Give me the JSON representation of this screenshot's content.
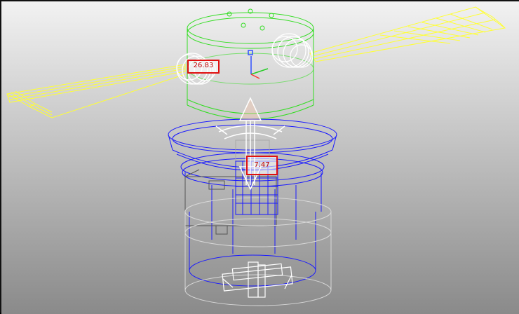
{
  "viewport": {
    "background_top": "#f2f2f2",
    "background_bottom": "#8a8a8a",
    "colors": {
      "blade": "#ffff33",
      "upper_housing": "#33dd22",
      "lower_housing": "#1a1aff",
      "base_ghost": "#d8d8d8",
      "gizmo": "#ffffff",
      "hub": "#a8a8a8",
      "dimension_box": "#e01010",
      "axis_x": "#ff3030",
      "axis_y": "#22cc22",
      "axis_z": "#3050ff"
    }
  },
  "dimensions": {
    "blade_angle": "26.83",
    "center_value": "7.47"
  },
  "icons": {
    "axis_triad": "xyz-triad-icon",
    "rotate_handle": "rotate-ring-icon",
    "move_handle": "move-arrow-icon"
  }
}
